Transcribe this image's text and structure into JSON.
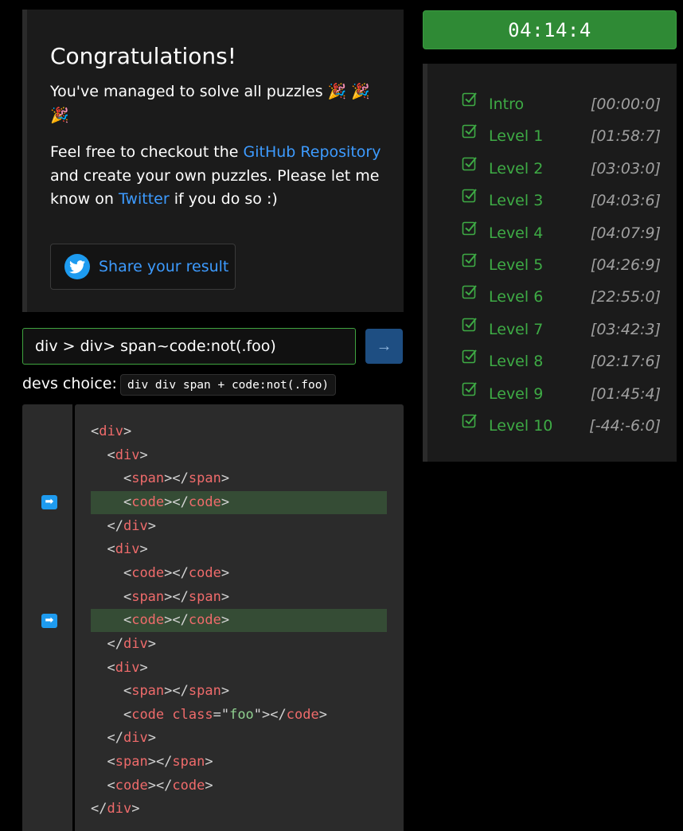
{
  "congrats": {
    "title": "Congratulations!",
    "message": "You've managed to solve all puzzles 🎉 🎉 🎉",
    "text_before_link1": "Feel free to checkout the ",
    "link1": "GitHub Repository",
    "text_mid": " and create your own puzzles. Please let me know on ",
    "link2": "Twitter",
    "text_after": " if you do so :)",
    "share_label": "Share your result"
  },
  "selector": {
    "value": "div > div> span~code:not(.foo)"
  },
  "devs": {
    "label": "devs choice:",
    "code": "div div span + code:not(.foo)"
  },
  "timer": {
    "value": "04:14:4"
  },
  "levels": [
    {
      "name": "Intro",
      "time": "[00:00:0]"
    },
    {
      "name": "Level 1",
      "time": "[01:58:7]"
    },
    {
      "name": "Level 2",
      "time": "[03:03:0]"
    },
    {
      "name": "Level 3",
      "time": "[04:03:6]"
    },
    {
      "name": "Level 4",
      "time": "[04:07:9]"
    },
    {
      "name": "Level 5",
      "time": "[04:26:9]"
    },
    {
      "name": "Level 6",
      "time": "[22:55:0]"
    },
    {
      "name": "Level 7",
      "time": "[03:42:3]"
    },
    {
      "name": "Level 8",
      "time": "[02:17:6]"
    },
    {
      "name": "Level 9",
      "time": "[01:45:4]"
    },
    {
      "name": "Level 10",
      "time": "[-44:-6:0]"
    }
  ],
  "colors": {
    "accent_green": "#3eab45",
    "timer_bg": "#2f8a35",
    "link_blue": "#3d9bff",
    "highlight": "#354c35"
  },
  "code_lines": [
    {
      "text": "<div>"
    },
    {
      "text": "  <div>"
    },
    {
      "text": "    <span></span>"
    },
    {
      "text": "    <code></code>",
      "highlighted": true
    },
    {
      "text": "  </div>"
    },
    {
      "text": "  <div>"
    },
    {
      "text": "    <code></code>"
    },
    {
      "text": "    <span></span>"
    },
    {
      "text": "    <code></code>",
      "highlighted": true
    },
    {
      "text": "  </div>"
    },
    {
      "text": "  <div>"
    },
    {
      "text": "    <span></span>"
    },
    {
      "text": "    <code class=\"foo\"></code>"
    },
    {
      "text": "  </div>"
    },
    {
      "text": "  <span></span>"
    },
    {
      "text": "  <code></code>"
    },
    {
      "text": "</div>"
    }
  ],
  "icons": {
    "share": "twitter-icon",
    "submit": "arrow-right-icon",
    "level": "checkbox-checked-icon",
    "match_marker": "arrow-right-icon"
  }
}
